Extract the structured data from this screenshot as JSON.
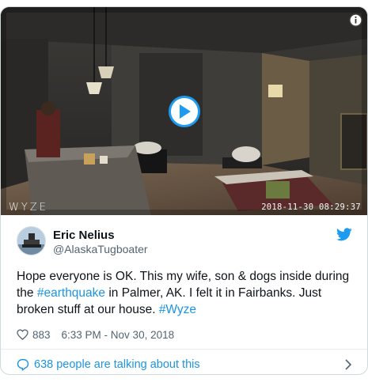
{
  "video": {
    "brand_watermark": "WYZE",
    "timestamp": "2018-11-30 08:29:37",
    "play_icon": "play-icon",
    "info_icon": "info-icon"
  },
  "author": {
    "name": "Eric Nelius",
    "handle": "@AlaskaTugboater",
    "platform_icon": "twitter-bird-icon"
  },
  "tweet": {
    "text_1": "Hope everyone is OK. This my wife,  son & dogs inside during the ",
    "hashtag_1": "#earthquake",
    "text_2": " in Palmer, AK. I felt it in Fairbanks. Just broken stuff at our house. ",
    "hashtag_2": "#Wyze"
  },
  "meta": {
    "likes": "883",
    "time_date": "6:33 PM - Nov 30, 2018"
  },
  "conversation": {
    "label": "638 people are talking about this"
  },
  "colors": {
    "link": "#1b95e0",
    "text": "#0f1419",
    "muted": "#536471",
    "border": "#cfd9de"
  }
}
